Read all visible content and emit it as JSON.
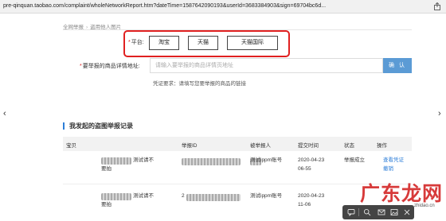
{
  "browser": {
    "url": "pre-qinquan.taobao.com/complaint/wholeNetworkReport.htm?dateTime=1587642090193&userId=3683384903&sign=69704bc6d..."
  },
  "breadcrumb": {
    "root": "全网举报",
    "separator": "›",
    "current": "盗用他人图片"
  },
  "platform": {
    "required_mark": "*",
    "label": "平台:",
    "options": [
      "淘宝",
      "天猫",
      "天猫国际"
    ]
  },
  "link_field": {
    "required_mark": "*",
    "label": "要举报的商品详情地址:",
    "placeholder": "请输入要举报的商品详情页地址",
    "confirm_label": "确 认",
    "hint": "凭证要求：请填写您要举报的商品的链接"
  },
  "nav": {
    "left_arrow": "‹",
    "right_arrow": "›"
  },
  "records": {
    "title": "我发起的盗图举报记录",
    "columns": [
      "宝贝",
      "举报ID",
      "被举报人",
      "提交时间",
      "状态",
      "操作"
    ],
    "rows": [
      {
        "item_line1": "测试请不",
        "item_line2": "要拍",
        "report_id": "",
        "reported": "测试ippm账号",
        "time_line1": "2020-04-23",
        "time_line2": "06-55",
        "status": "举报成立",
        "action_line1": "查看凭证",
        "action_line2": "撤销"
      },
      {
        "item_line1": "测试请不",
        "item_line2": "要拍",
        "report_id": "2",
        "reported": "测试ippm账号",
        "time_line1": "2020-04-23",
        "time_line2": "11-06",
        "status": "",
        "action_line1": "",
        "action_line2": ""
      }
    ]
  },
  "watermark": {
    "text": "广东龙网",
    "sub": "zhidao.cn"
  },
  "colors": {
    "accent": "#5b9bd5",
    "highlight_border": "#e02020",
    "link": "#2d7ed8",
    "watermark": "#d73a3a"
  }
}
